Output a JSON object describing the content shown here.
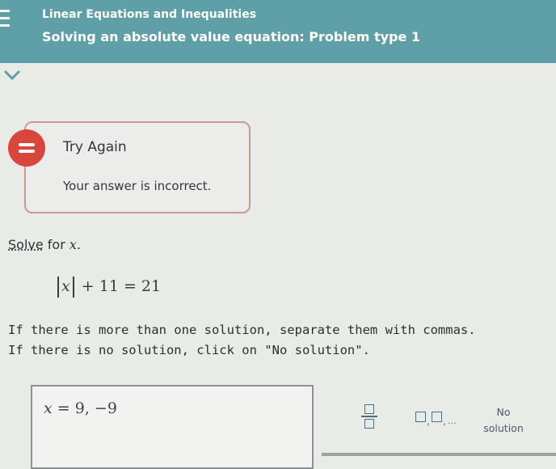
{
  "header": {
    "topic": "Linear Equations and Inequalities",
    "title": "Solving an absolute value equation: Problem type 1"
  },
  "feedback": {
    "heading": "Try Again",
    "message": "Your answer is incorrect."
  },
  "problem": {
    "solve_word": "Solve",
    "solve_rest": " for ",
    "variable": "x",
    "period": ".",
    "equation_rhs": "+ 11 = 21",
    "instruction_1": "If there is more than one solution, separate them with commas.",
    "instruction_2": "If there is no solution, click on \"No solution\"."
  },
  "answer": {
    "variable": "x",
    "value": "= 9, −9"
  },
  "tools": {
    "no_solution_line1": "No",
    "no_solution_line2": "solution",
    "list_dots": "..."
  },
  "colors": {
    "header": "#5f9fa8",
    "warning": "#d9463c",
    "feedback_border": "#c89a94"
  }
}
